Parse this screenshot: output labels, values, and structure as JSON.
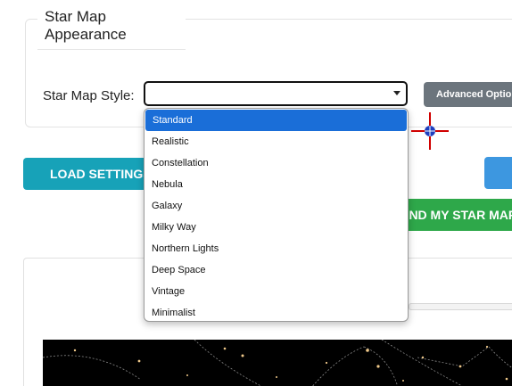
{
  "appearance": {
    "legend": "Star Map Appearance",
    "style_label": "Star Map Style:",
    "selected_value": "",
    "advanced_button": "Advanced Options"
  },
  "dropdown": {
    "options": [
      "Standard",
      "Realistic",
      "Constellation",
      "Nebula",
      "Galaxy",
      "Milky Way",
      "Northern Lights",
      "Deep Space",
      "Vintage",
      "Minimalist"
    ],
    "highlighted": "Standard"
  },
  "actions": {
    "load_settings": "LOAD SETTINGS",
    "find_star_map": "FIND MY STAR MAP"
  },
  "colors": {
    "load_button": "#17a2b8",
    "find_button": "#2ea84a",
    "blue_button": "#3d97e0",
    "highlight": "#1a6ed8",
    "advanced_button": "#6c757d"
  }
}
